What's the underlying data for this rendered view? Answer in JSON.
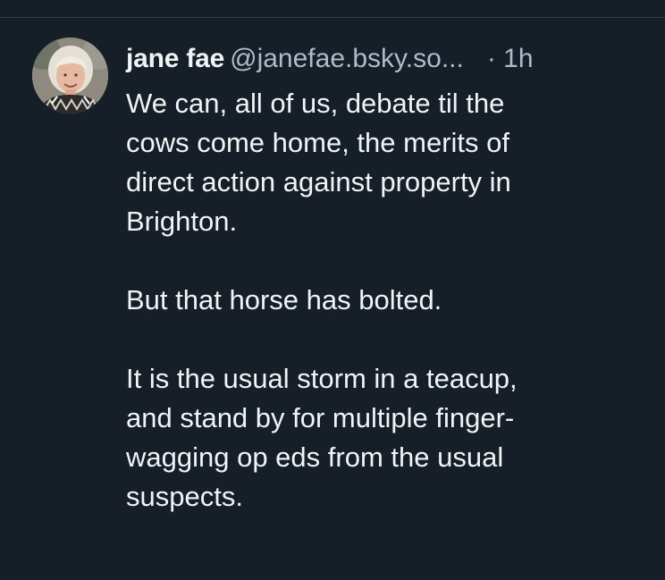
{
  "post": {
    "author_name": "jane fae",
    "author_handle": "@janefae.bsky.so...",
    "separator": "·",
    "time": "1h",
    "avatar_icon": "user-avatar-photo",
    "paragraphs": [
      [
        "We can, all of us, debate til the",
        "cows come home, the merits of",
        "direct action against property in",
        "Brighton."
      ],
      [
        "But that horse has bolted."
      ],
      [
        "It is the usual storm in a teacup,",
        "and stand by for multiple finger-",
        "wagging op eds from the usual",
        "suspects."
      ]
    ]
  },
  "colors": {
    "background": "#161e27",
    "text_primary": "#f1f3f5",
    "text_secondary": "#aebbc9",
    "divider": "#2e4052"
  }
}
